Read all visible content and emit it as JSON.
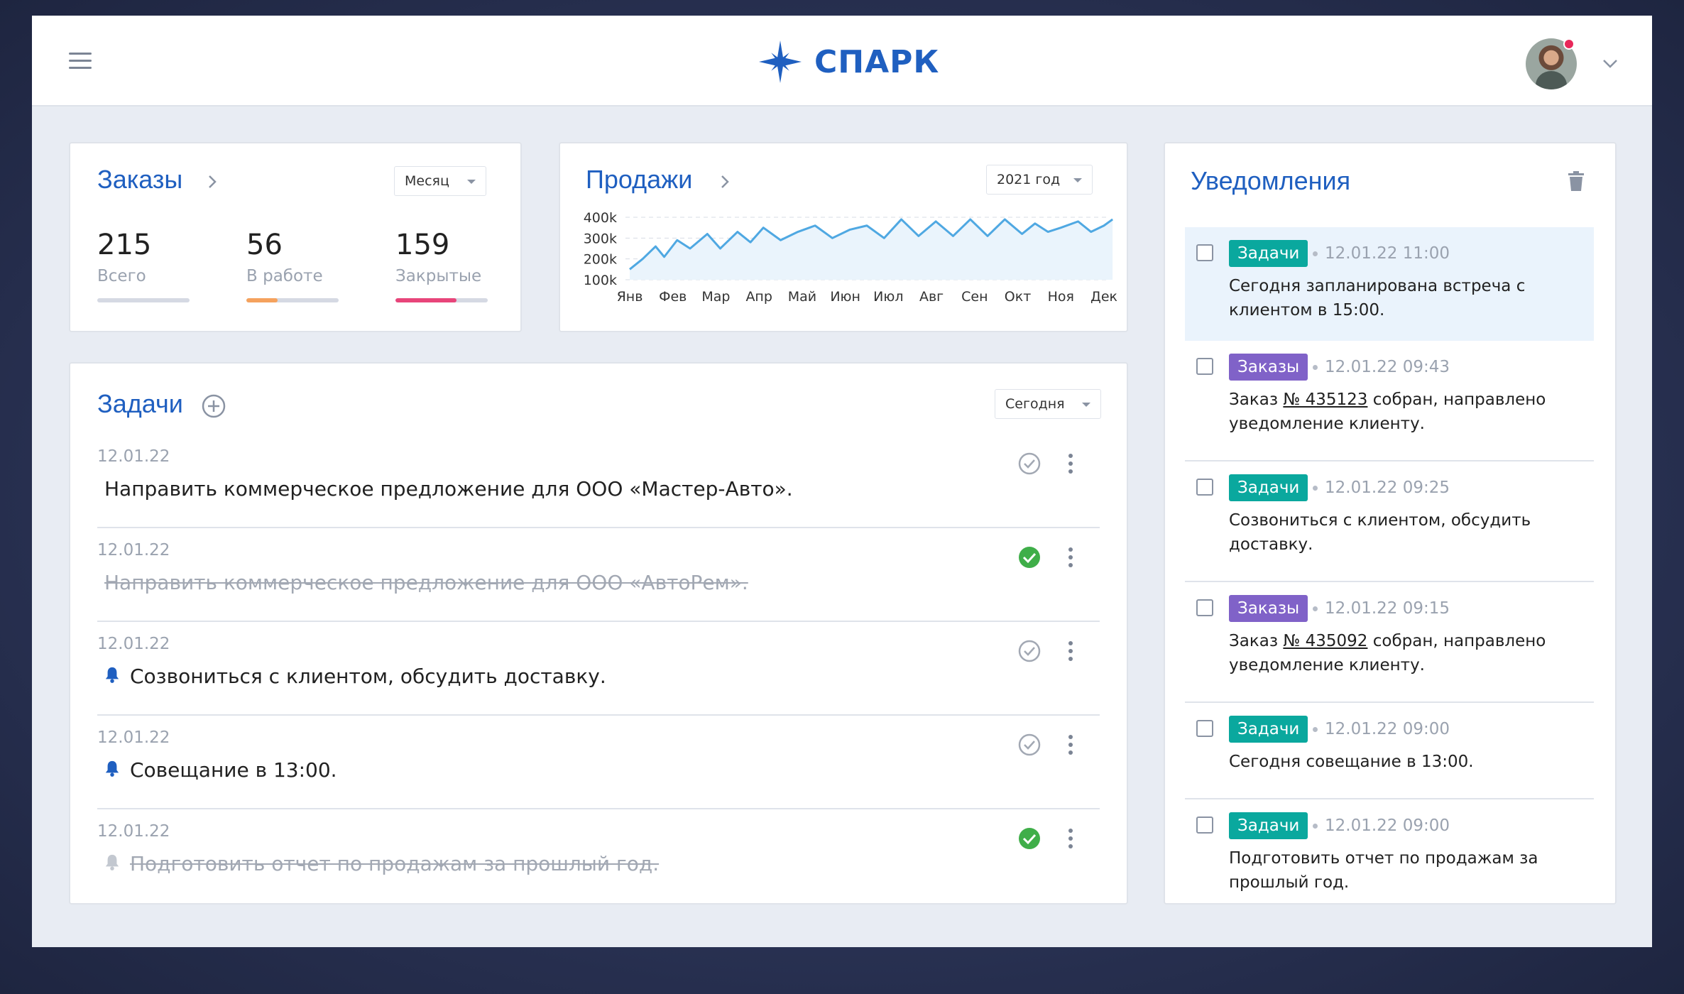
{
  "app": {
    "brand": "СПАРК"
  },
  "orders": {
    "title": "Заказы",
    "period": "Месяц",
    "stats": [
      {
        "value": "215",
        "label": "Всего",
        "progress": 0,
        "color": "#d5d9e3"
      },
      {
        "value": "56",
        "label": "В работе",
        "progress": 0.34,
        "color": "#f5a25d"
      },
      {
        "value": "159",
        "label": "Закрытые",
        "progress": 0.66,
        "color": "#e8457a"
      }
    ]
  },
  "sales": {
    "title": "Продажи",
    "period": "2021 год"
  },
  "chart_data": {
    "type": "line",
    "title": "",
    "xlabel": "",
    "ylabel": "",
    "ylim": [
      100000,
      400000
    ],
    "ytick_labels": [
      "400k",
      "300k",
      "200k",
      "100k"
    ],
    "yticks": [
      400000,
      300000,
      200000,
      100000
    ],
    "categories": [
      "Янв",
      "Фев",
      "Мар",
      "Апр",
      "Май",
      "Июн",
      "Июл",
      "Авг",
      "Сен",
      "Окт",
      "Ноя",
      "Дек"
    ],
    "x": [
      0,
      0.3,
      0.6,
      0.8,
      1.1,
      1.4,
      1.8,
      2.1,
      2.5,
      2.8,
      3.1,
      3.5,
      3.9,
      4.3,
      4.7,
      5.1,
      5.5,
      5.9,
      6.3,
      6.7,
      7.1,
      7.5,
      7.9,
      8.3,
      8.7,
      9.1,
      9.4,
      9.7,
      10.0,
      10.4,
      10.7,
      11.0,
      11.2
    ],
    "values": [
      150000,
      200000,
      260000,
      210000,
      290000,
      250000,
      320000,
      250000,
      330000,
      280000,
      350000,
      290000,
      330000,
      360000,
      300000,
      340000,
      360000,
      300000,
      390000,
      310000,
      380000,
      310000,
      390000,
      310000,
      390000,
      320000,
      370000,
      330000,
      350000,
      380000,
      330000,
      360000,
      390000
    ],
    "grid": true,
    "legend": "none"
  },
  "tasks": {
    "title": "Задачи",
    "filter": "Сегодня",
    "items": [
      {
        "date": "12.01.22",
        "text": "Направить коммерческое предложение для ООО «Мастер-Авто».",
        "done": false,
        "bell": false
      },
      {
        "date": "12.01.22",
        "text": "Направить коммерческое предложение для ООО «АвтоРем».",
        "done": true,
        "bell": false
      },
      {
        "date": "12.01.22",
        "text": "Созвониться с клиентом, обсудить доставку.",
        "done": false,
        "bell": true
      },
      {
        "date": "12.01.22",
        "text": "Совещание в 13:00.",
        "done": false,
        "bell": true
      },
      {
        "date": "12.01.22",
        "text": "Подготовить отчет по продажам за прошлый год.",
        "done": true,
        "bell": true
      }
    ]
  },
  "notifications": {
    "title": "Уведомления",
    "items": [
      {
        "tag": "Задачи",
        "tag_color": "#0aa89e",
        "time": "12.01.22 11:00",
        "line1": "Сегодня запланирована встреча с",
        "line2": "клиентом в 15:00.",
        "active": true
      },
      {
        "tag": "Заказы",
        "tag_color": "#8062c8",
        "time": "12.01.22 09:43",
        "pre": "Заказ ",
        "link": "№ 435123",
        "post": " собран, направлено",
        "line2": "уведомление клиенту.",
        "active": false
      },
      {
        "tag": "Задачи",
        "tag_color": "#0aa89e",
        "time": "12.01.22 09:25",
        "line1": "Созвониться с клиентом, обсудить",
        "line2": "доставку.",
        "active": false
      },
      {
        "tag": "Заказы",
        "tag_color": "#8062c8",
        "time": "12.01.22 09:15",
        "pre": "Заказ ",
        "link": "№ 435092",
        "post": " собран, направлено",
        "line2": "уведомление клиенту.",
        "active": false
      },
      {
        "tag": "Задачи",
        "tag_color": "#0aa89e",
        "time": "12.01.22 09:00",
        "line1": "Сегодня совещание в 13:00.",
        "line2": "",
        "active": false
      },
      {
        "tag": "Задачи",
        "tag_color": "#0aa89e",
        "time": "12.01.22 09:00",
        "line1": "Подготовить отчет по продажам за",
        "line2": "прошлый год.",
        "active": false
      }
    ]
  },
  "icons": {
    "menu": "menu-icon",
    "logo": "star-logo-icon",
    "user_chevron": "chevron-down-icon",
    "card_chevron": "chevron-right-icon",
    "add": "plus-circle-icon",
    "check": "check-circle-icon",
    "more": "more-vertical-icon",
    "bell": "bell-icon",
    "trash": "trash-icon"
  }
}
